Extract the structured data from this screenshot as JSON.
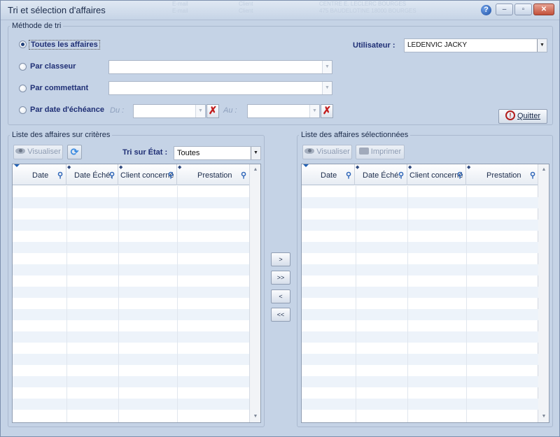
{
  "window": {
    "title": "Tri et sélection d'affaires",
    "background_text": [
      "E-mail",
      "Client",
      "CENTRE E. LECLERC BOURGES",
      "E-mail",
      "Client",
      "475 BAUDELOTINE 18000 BOURGES"
    ]
  },
  "tri": {
    "legend": "Méthode de tri",
    "options": [
      {
        "label": "Toutes les affaires",
        "checked": true
      },
      {
        "label": "Par classeur",
        "checked": false
      },
      {
        "label": "Par commettant",
        "checked": false
      },
      {
        "label": "Par date d'échéance",
        "checked": false
      }
    ],
    "du_label": "Du :",
    "au_label": "Au :",
    "classeur_value": "",
    "commettant_value": "",
    "du_value": "",
    "au_value": "",
    "user_label": "Utilisateur :",
    "user_value": "LEDENVIC JACKY",
    "quit_label": "Quitter"
  },
  "left": {
    "legend": "Liste des affaires sur critères",
    "visualiser_label": "Visualiser",
    "tri_etat_label": "Tri sur État :",
    "etat_value": "Toutes",
    "columns": [
      "Date",
      "Date Éché.",
      "Client concerné",
      "Prestation"
    ]
  },
  "right": {
    "legend": "Liste des affaires sélectionnées",
    "visualiser_label": "Visualiser",
    "imprimer_label": "Imprimer",
    "columns": [
      "Date",
      "Date Éché.",
      "Client concerné",
      "Prestation"
    ]
  },
  "transfer": {
    "buttons": [
      ">",
      ">>",
      "<",
      "<<"
    ]
  },
  "colors": {
    "window_bg": "#c5d3e6",
    "label_blue": "#1f2f75",
    "row_alt": "#edf3fa",
    "delete_red": "#c21d1d"
  }
}
